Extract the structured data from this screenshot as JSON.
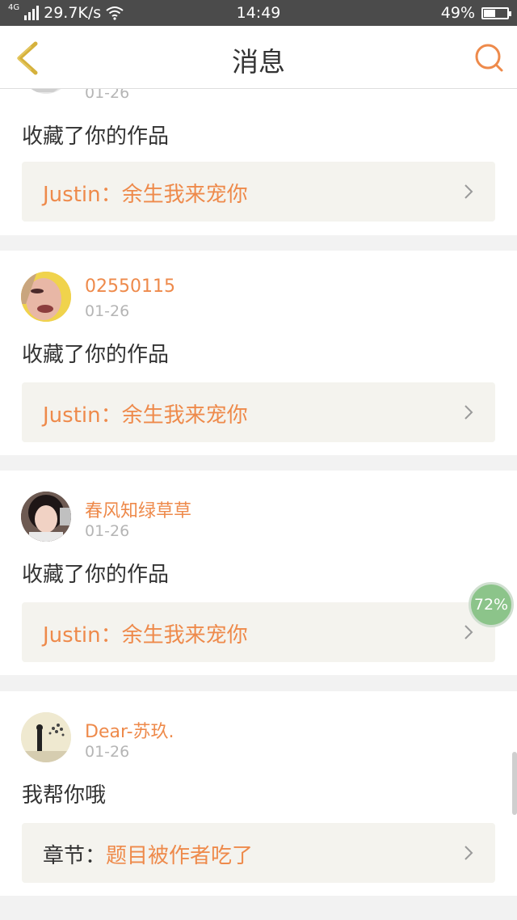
{
  "status_bar": {
    "network": "4G",
    "speed": "29.7K/s",
    "time": "14:49",
    "battery": "49%",
    "battery_level": 0.49
  },
  "header": {
    "title": "消息",
    "back_icon": "chevron-left-icon",
    "search_icon": "search-icon",
    "accent": "#ee8a4b"
  },
  "messages": [
    {
      "user": "",
      "date": "01-26",
      "action": "收藏了你的作品",
      "ref_prefix": "",
      "ref_text": "Justin：余生我来宠你"
    },
    {
      "user": "02550115",
      "date": "01-26",
      "action": "收藏了你的作品",
      "ref_prefix": "",
      "ref_text": "Justin：余生我来宠你"
    },
    {
      "user": "春风知绿草草",
      "date": "01-26",
      "action": "收藏了你的作品",
      "ref_prefix": "",
      "ref_text": "Justin：余生我来宠你"
    },
    {
      "user": "Dear-苏玖.",
      "date": "01-26",
      "action": "我帮你哦",
      "ref_prefix": "章节：",
      "ref_text": "题目被作者吃了"
    }
  ],
  "floating_badge": "72%"
}
